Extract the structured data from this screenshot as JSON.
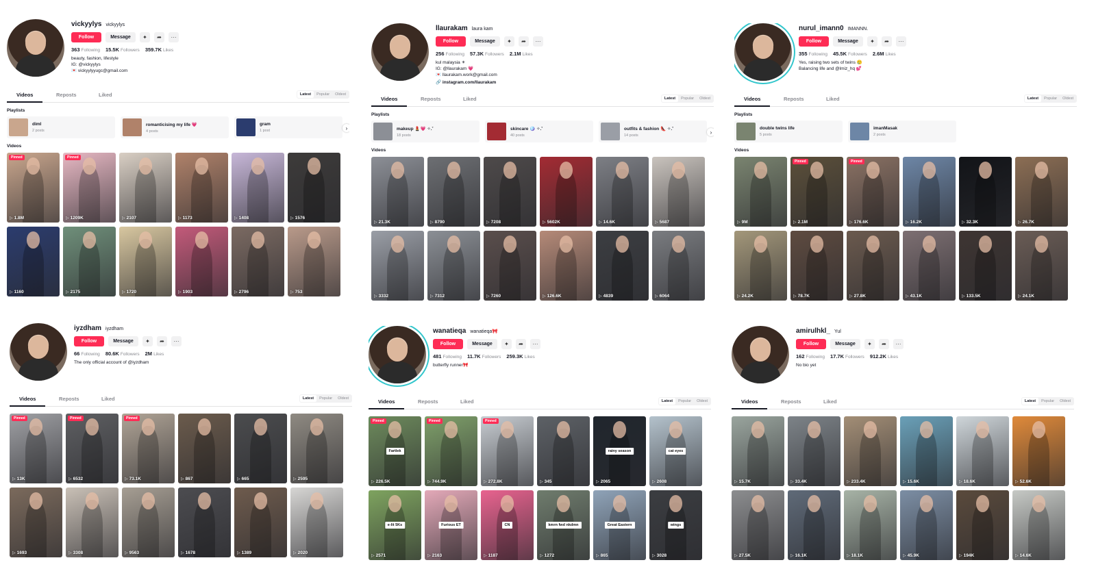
{
  "colors": {
    "accent": "#fe2c55",
    "ring": "#33c6cc"
  },
  "icons": [
    "add-friend-icon",
    "share-icon",
    "more-icon",
    "chevron-right-icon",
    "play-icon"
  ],
  "common": {
    "follow": "Follow",
    "message": "Message",
    "following": "Following",
    "followers": "Followers",
    "likes": "Likes",
    "tab_videos": "Videos",
    "tab_reposts": "Reposts",
    "tab_liked": "Liked",
    "sort_latest": "Latest",
    "sort_popular": "Popular",
    "sort_oldest": "Oldest",
    "playlists": "Playlists",
    "videos": "Videos",
    "pinned": "Pinned",
    "more": "···",
    "arrow": "›",
    "add": "✦",
    "share": "➦"
  },
  "profiles": [
    {
      "username": "vickyylys",
      "display": "vickyylys",
      "following": "363",
      "followers": "15.5K",
      "likes": "359.7K",
      "bio": "beauty, fashion, lifestyle\nIG: @vickyylys\n💌 vickyylyyugc@gmail.com",
      "link": "",
      "playlists": [
        {
          "title": "diml",
          "count": "2 posts"
        },
        {
          "title": "romanticising my life 💗",
          "count": "4 posts"
        },
        {
          "title": "gram",
          "count": "1 post"
        }
      ],
      "videos": [
        {
          "views": "1.8M",
          "pinned": true,
          "caption": ""
        },
        {
          "views": "1209K",
          "pinned": true,
          "caption": ""
        },
        {
          "views": "2107",
          "pinned": false,
          "caption": ""
        },
        {
          "views": "1173",
          "pinned": false,
          "caption": ""
        },
        {
          "views": "1408",
          "pinned": false,
          "caption": ""
        },
        {
          "views": "1576",
          "pinned": false,
          "caption": ""
        },
        {
          "views": "1160",
          "pinned": false,
          "caption": ""
        },
        {
          "views": "2175",
          "pinned": false,
          "caption": ""
        },
        {
          "views": "1720",
          "pinned": false,
          "caption": ""
        },
        {
          "views": "1903",
          "pinned": false,
          "caption": ""
        },
        {
          "views": "2796",
          "pinned": false,
          "caption": ""
        },
        {
          "views": "753",
          "pinned": false,
          "caption": ""
        }
      ]
    },
    {
      "username": "llaurakam",
      "display": "laura kam",
      "following": "256",
      "followers": "57.3K",
      "likes": "2.1M",
      "bio": "kul malaysia ☀\nIG: @llaurakam 💗\n💌 llaurakam.work@gmail.com",
      "link": "🔗 instagram.com/llaurakam",
      "playlists": [
        {
          "title": "makeup 💄💗 ✧.˚",
          "count": "18 posts"
        },
        {
          "title": "skincare 🪩 ✧.˚",
          "count": "40 posts"
        },
        {
          "title": "outfits & fashion 👠 ✧.˚",
          "count": "14 posts"
        }
      ],
      "videos": [
        {
          "views": "21.3K",
          "pinned": false,
          "caption": ""
        },
        {
          "views": "8790",
          "pinned": false,
          "caption": ""
        },
        {
          "views": "7208",
          "pinned": false,
          "caption": ""
        },
        {
          "views": "5602K",
          "pinned": false,
          "caption": ""
        },
        {
          "views": "14.6K",
          "pinned": false,
          "caption": ""
        },
        {
          "views": "5687",
          "pinned": false,
          "caption": ""
        },
        {
          "views": "3332",
          "pinned": false,
          "caption": ""
        },
        {
          "views": "7312",
          "pinned": false,
          "caption": ""
        },
        {
          "views": "7260",
          "pinned": false,
          "caption": ""
        },
        {
          "views": "126.6K",
          "pinned": false,
          "caption": ""
        },
        {
          "views": "4839",
          "pinned": false,
          "caption": ""
        },
        {
          "views": "6064",
          "pinned": false,
          "caption": ""
        }
      ]
    },
    {
      "username": "nurul_imann0",
      "display": "IMANNN.",
      "following": "355",
      "followers": "45.5K",
      "likes": "2.6M",
      "bio": "Yes, raising two sets of twins 🥲\nBalancing life and @lmiz_hq 💕",
      "link": "",
      "playlists": [
        {
          "title": "double twins life",
          "count": "5 posts"
        },
        {
          "title": "imanMasak",
          "count": "2 posts"
        }
      ],
      "videos": [
        {
          "views": "9M",
          "pinned": false,
          "caption": ""
        },
        {
          "views": "2.1M",
          "pinned": true,
          "caption": ""
        },
        {
          "views": "176.6K",
          "pinned": true,
          "caption": ""
        },
        {
          "views": "16.2K",
          "pinned": false,
          "caption": ""
        },
        {
          "views": "32.3K",
          "pinned": false,
          "caption": ""
        },
        {
          "views": "26.7K",
          "pinned": false,
          "caption": ""
        },
        {
          "views": "24.2K",
          "pinned": false,
          "caption": ""
        },
        {
          "views": "78.7K",
          "pinned": false,
          "caption": ""
        },
        {
          "views": "27.8K",
          "pinned": false,
          "caption": ""
        },
        {
          "views": "43.1K",
          "pinned": false,
          "caption": ""
        },
        {
          "views": "133.5K",
          "pinned": false,
          "caption": ""
        },
        {
          "views": "24.1K",
          "pinned": false,
          "caption": ""
        }
      ]
    },
    {
      "username": "iyzdham",
      "display": "iyzdham",
      "following": "66",
      "followers": "80.6K",
      "likes": "2M",
      "bio": "The only official account of @iyzdham",
      "link": "",
      "playlists": [],
      "videos": [
        {
          "views": "13K",
          "pinned": true,
          "caption": ""
        },
        {
          "views": "6532",
          "pinned": true,
          "caption": ""
        },
        {
          "views": "73.1K",
          "pinned": true,
          "caption": ""
        },
        {
          "views": "867",
          "pinned": false,
          "caption": ""
        },
        {
          "views": "665",
          "pinned": false,
          "caption": ""
        },
        {
          "views": "2595",
          "pinned": false,
          "caption": ""
        },
        {
          "views": "1693",
          "pinned": false,
          "caption": ""
        },
        {
          "views": "3308",
          "pinned": false,
          "caption": ""
        },
        {
          "views": "9563",
          "pinned": false,
          "caption": ""
        },
        {
          "views": "1678",
          "pinned": false,
          "caption": ""
        },
        {
          "views": "1389",
          "pinned": false,
          "caption": ""
        },
        {
          "views": "2020",
          "pinned": false,
          "caption": ""
        }
      ]
    },
    {
      "username": "wanatieqa",
      "display": "wanatieqa🎀",
      "following": "481",
      "followers": "11.7K",
      "likes": "259.3K",
      "bio": "butterfly runner🎀",
      "link": "",
      "playlists": [],
      "videos": [
        {
          "views": "226.5K",
          "pinned": true,
          "caption": "Fartlek"
        },
        {
          "views": "744.9K",
          "pinned": true,
          "caption": ""
        },
        {
          "views": "272.8K",
          "pinned": true,
          "caption": ""
        },
        {
          "views": "345",
          "pinned": false,
          "caption": ""
        },
        {
          "views": "2065",
          "pinned": false,
          "caption": "rainy season"
        },
        {
          "views": "2608",
          "pinned": false,
          "caption": "cat eyes"
        },
        {
          "views": "2571",
          "pinned": false,
          "caption": "e-lit 5Ks"
        },
        {
          "views": "2163",
          "pinned": false,
          "caption": "Furious ET"
        },
        {
          "views": "1187",
          "pinned": false,
          "caption": "CN"
        },
        {
          "views": "1272",
          "pinned": false,
          "caption": "kmrn fwd nkdmn"
        },
        {
          "views": "865",
          "pinned": false,
          "caption": "Great Eastern"
        },
        {
          "views": "3028",
          "pinned": false,
          "caption": "wings"
        }
      ]
    },
    {
      "username": "amirulhkl_",
      "display": "Yul",
      "following": "162",
      "followers": "17.7K",
      "likes": "912.2K",
      "bio": "No bio yet",
      "link": "",
      "playlists": [],
      "videos": [
        {
          "views": "15.7K",
          "pinned": false,
          "caption": ""
        },
        {
          "views": "33.4K",
          "pinned": false,
          "caption": ""
        },
        {
          "views": "233.4K",
          "pinned": false,
          "caption": ""
        },
        {
          "views": "15.6K",
          "pinned": false,
          "caption": ""
        },
        {
          "views": "18.6K",
          "pinned": false,
          "caption": ""
        },
        {
          "views": "52.6K",
          "pinned": false,
          "caption": ""
        },
        {
          "views": "27.5K",
          "pinned": false,
          "caption": ""
        },
        {
          "views": "16.1K",
          "pinned": false,
          "caption": ""
        },
        {
          "views": "18.1K",
          "pinned": false,
          "caption": ""
        },
        {
          "views": "45.9K",
          "pinned": false,
          "caption": ""
        },
        {
          "views": "194K",
          "pinned": false,
          "caption": ""
        },
        {
          "views": "14.6K",
          "pinned": false,
          "caption": ""
        }
      ]
    }
  ]
}
